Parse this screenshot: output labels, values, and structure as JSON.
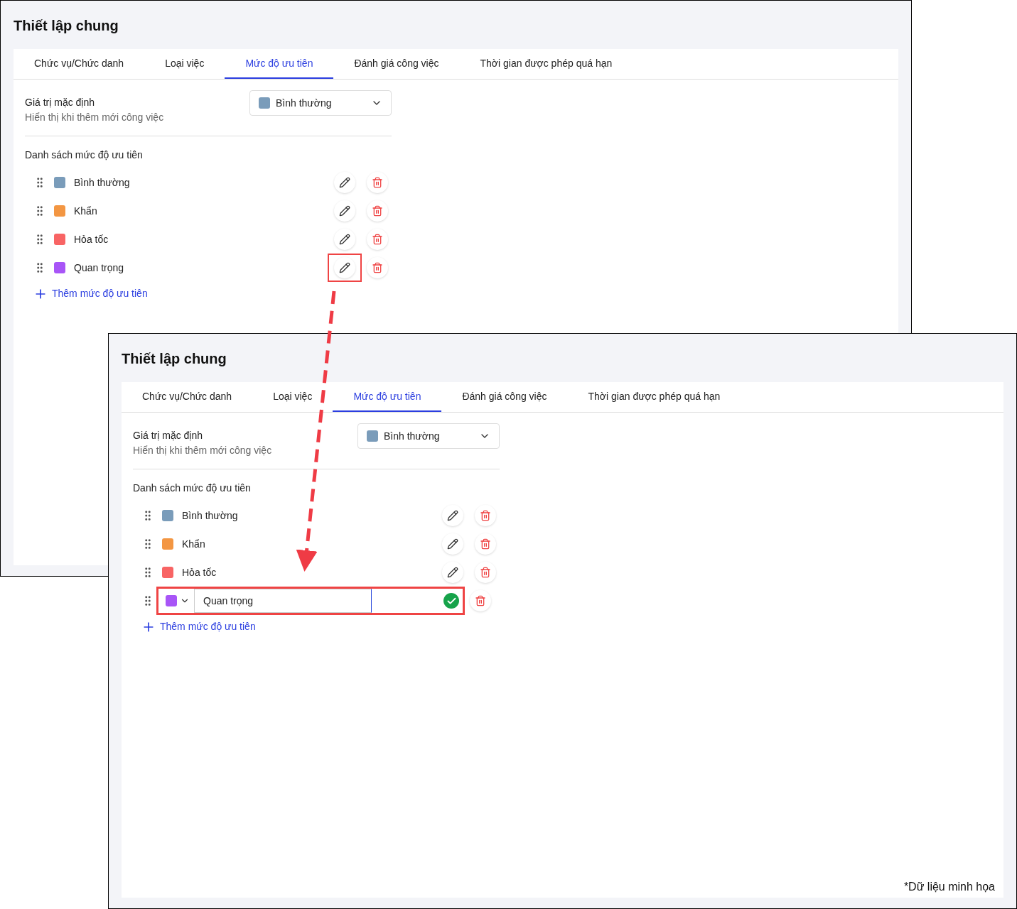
{
  "screenshots": [
    {
      "title": "Thiết lập chung",
      "tabs": [
        {
          "label": "Chức vụ/Chức danh",
          "selected": false
        },
        {
          "label": "Loại việc",
          "selected": false
        },
        {
          "label": "Mức độ ưu tiên",
          "selected": true
        },
        {
          "label": "Đánh giá công việc",
          "selected": false
        },
        {
          "label": "Thời gian được phép quá hạn",
          "selected": false
        }
      ],
      "default_value": {
        "label": "Giá trị mặc định",
        "hint": "Hiển thị khi thêm mới công việc",
        "value": "Bình thường",
        "color": "#7a9cba"
      },
      "list_title": "Danh sách mức độ ưu tiên",
      "items": [
        {
          "label": "Bình thường",
          "color": "#7a9cba",
          "editing": false,
          "highlighted": false
        },
        {
          "label": "Khẩn",
          "color": "#f39642",
          "editing": false,
          "highlighted": false
        },
        {
          "label": "Hỏa tốc",
          "color": "#f86464",
          "editing": false,
          "highlighted": false
        },
        {
          "label": "Quan trọng",
          "color": "#a855f7",
          "editing": false,
          "highlighted": true
        }
      ],
      "add_button": "Thêm mức độ ưu tiên"
    },
    {
      "title": "Thiết lập chung",
      "tabs": [
        {
          "label": "Chức vụ/Chức danh",
          "selected": false
        },
        {
          "label": "Loại việc",
          "selected": false
        },
        {
          "label": "Mức độ ưu tiên",
          "selected": true
        },
        {
          "label": "Đánh giá công việc",
          "selected": false
        },
        {
          "label": "Thời gian được phép quá hạn",
          "selected": false
        }
      ],
      "default_value": {
        "label": "Giá trị mặc định",
        "hint": "Hiển thị khi thêm mới công việc",
        "value": "Bình thường",
        "color": "#7a9cba"
      },
      "list_title": "Danh sách mức độ ưu tiên",
      "items": [
        {
          "label": "Bình thường",
          "color": "#7a9cba",
          "editing": false,
          "highlighted": false
        },
        {
          "label": "Khẩn",
          "color": "#f39642",
          "editing": false,
          "highlighted": false
        },
        {
          "label": "Hỏa tốc",
          "color": "#f86464",
          "editing": false,
          "highlighted": false
        },
        {
          "label": "Quan trọng",
          "color": "#a855f7",
          "editing": true,
          "highlighted": true
        }
      ],
      "add_button": "Thêm mức độ ưu tiên",
      "note": "*Dữ liệu minh họa"
    }
  ]
}
